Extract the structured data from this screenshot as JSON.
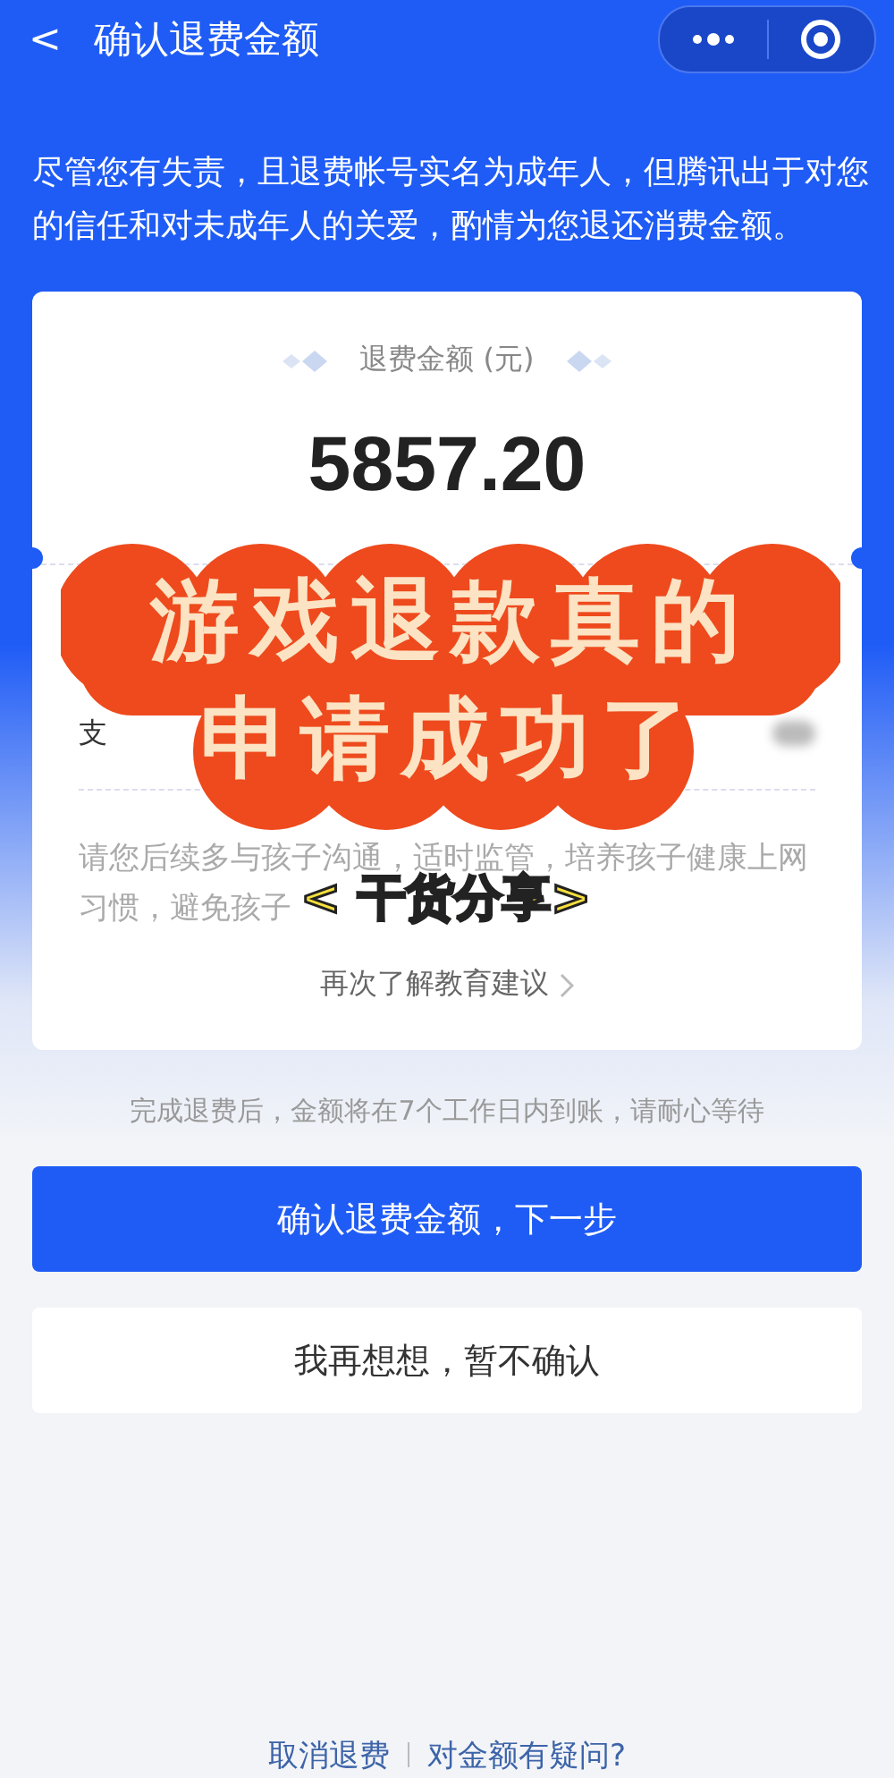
{
  "nav": {
    "back": "<",
    "title": "确认退费金额"
  },
  "intro": "尽管您有失责，且退费帐号实名为成年人，但腾讯出于对您的信任和对未成年人的关爱，酌情为您退还消费金额。",
  "card": {
    "label": "退费金额 (元)",
    "amount": "5857.20",
    "row_label": "支",
    "advice": [
      "请您后续多与孩子沟通，适时监管，培养孩子健康上网",
      "习惯，避免孩子"
    ],
    "link": "再次了解教育建议"
  },
  "note": "完成退费后，金额将在7个工作日内到账，请耐心等待",
  "buttons": [
    {
      "label": "确认退费金额，下一步",
      "kind": "primary"
    },
    {
      "label": "我再想想，暂不确认",
      "kind": "secondary"
    }
  ],
  "footer": [
    "取消退费",
    "对金额有疑问?"
  ],
  "overlay": {
    "headline": [
      "游戏退款真的",
      "申请成功了"
    ],
    "caption": "< 干货分享>"
  }
}
